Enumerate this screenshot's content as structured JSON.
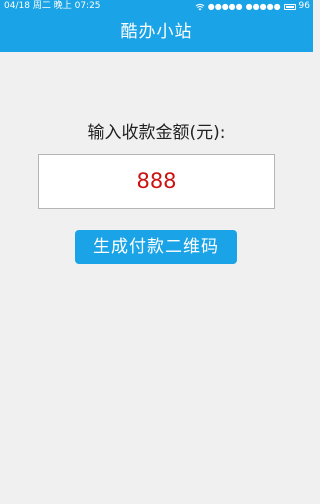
{
  "status_bar": {
    "date": "04/18",
    "weekday": "周二",
    "period": "晚上",
    "time": "07:25",
    "signal_1": "●●●●●",
    "signal_2": "●●●●●",
    "battery": "96"
  },
  "header": {
    "title": "酷办小站"
  },
  "form": {
    "prompt": "输入收款金额(元):",
    "amount_value": "888",
    "generate_button_label": "生成付款二维码"
  },
  "colors": {
    "brand": "#1aa3e6",
    "amount_text": "#cc1111",
    "background": "#f0f0f0"
  },
  "icons": {
    "wifi": "wifi-icon",
    "battery": "battery-icon"
  }
}
